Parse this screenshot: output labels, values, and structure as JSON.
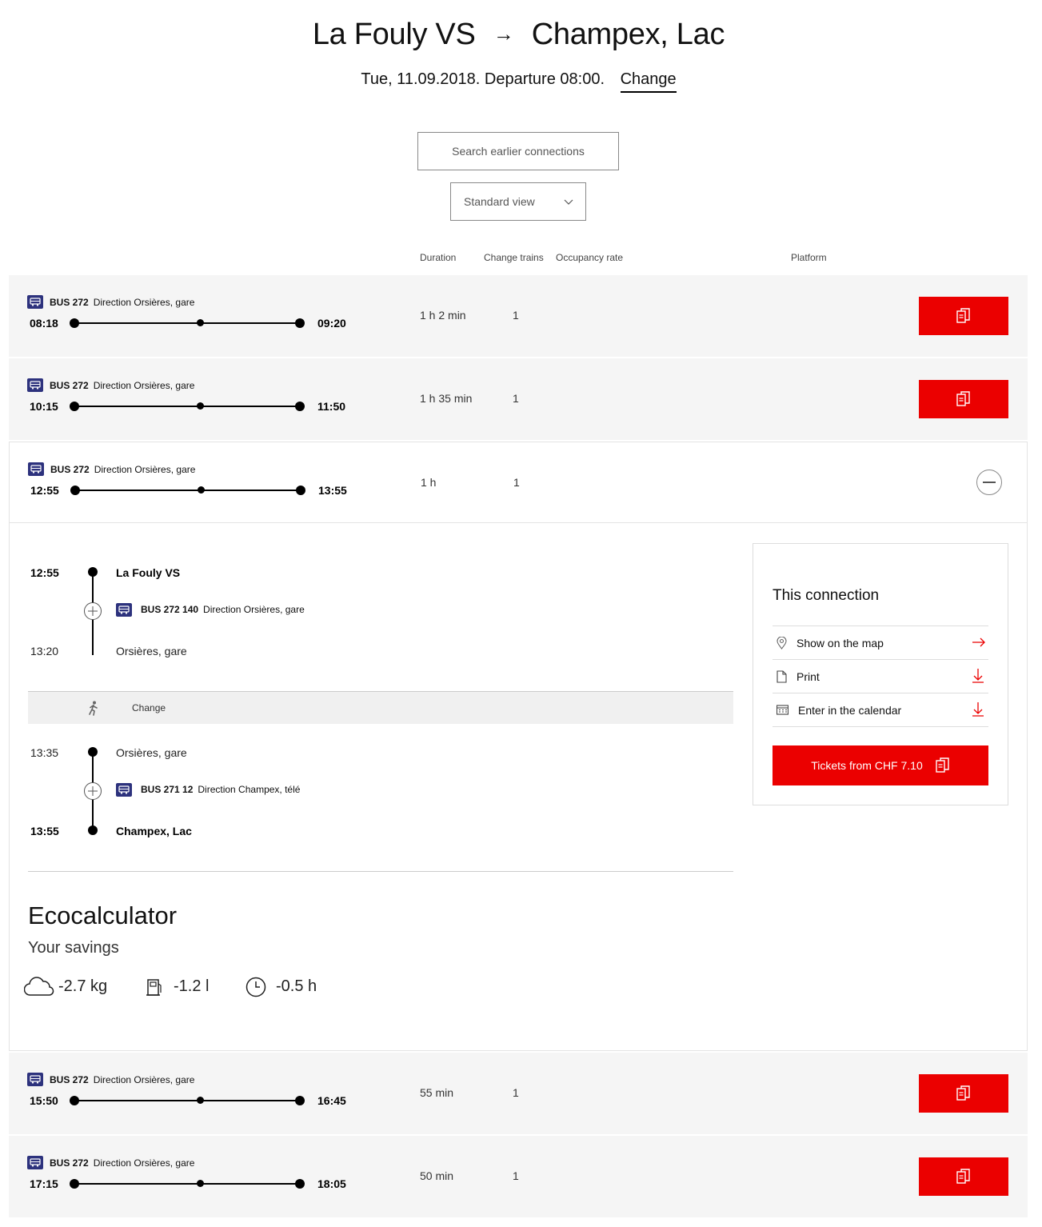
{
  "header": {
    "from": "La Fouly VS",
    "arrow": "→",
    "to": "Champex, Lac",
    "date_line": "Tue, 11.09.2018. Departure 08:00.",
    "change_label": "Change"
  },
  "controls": {
    "earlier_label": "Search earlier connections",
    "view_label": "Standard view"
  },
  "columns": {
    "duration": "Duration",
    "changes": "Change trains",
    "occupancy": "Occupancy rate",
    "platform": "Platform"
  },
  "connections": [
    {
      "line": "BUS 272",
      "direction": "Direction Orsières, gare",
      "dep": "08:18",
      "arr": "09:20",
      "duration": "1 h 2 min",
      "changes": "1"
    },
    {
      "line": "BUS 272",
      "direction": "Direction Orsières, gare",
      "dep": "10:15",
      "arr": "11:50",
      "duration": "1 h 35 min",
      "changes": "1"
    },
    {
      "line": "BUS 272",
      "direction": "Direction Orsières, gare",
      "dep": "12:55",
      "arr": "13:55",
      "duration": "1 h",
      "changes": "1"
    },
    {
      "line": "BUS 272",
      "direction": "Direction Orsières, gare",
      "dep": "15:50",
      "arr": "16:45",
      "duration": "55 min",
      "changes": "1"
    },
    {
      "line": "BUS 272",
      "direction": "Direction Orsières, gare",
      "dep": "17:15",
      "arr": "18:05",
      "duration": "50 min",
      "changes": "1"
    }
  ],
  "detail": {
    "leg1": {
      "dep_time": "12:55",
      "dep_stop": "La Fouly VS",
      "line": "BUS 272 140",
      "direction": "Direction Orsières, gare",
      "arr_time": "13:20",
      "arr_stop": "Orsières, gare"
    },
    "change_label": "Change",
    "leg2": {
      "dep_time": "13:35",
      "dep_stop": "Orsières, gare",
      "line": "BUS 271 12",
      "direction": "Direction Champex, télé",
      "arr_time": "13:55",
      "arr_stop": "Champex, Lac"
    },
    "eco": {
      "title": "Ecocalculator",
      "subtitle": "Your savings",
      "co2": "-2.7 kg",
      "fuel": "-1.2 l",
      "time": "-0.5 h"
    },
    "card": {
      "title": "This connection",
      "map": "Show on the map",
      "print": "Print",
      "calendar": "Enter in the calendar",
      "tickets": "Tickets from CHF 7.10"
    }
  },
  "colors": {
    "accent": "#eb0000",
    "bus_icon": "#2d327d",
    "row_bg": "#f5f5f5"
  }
}
